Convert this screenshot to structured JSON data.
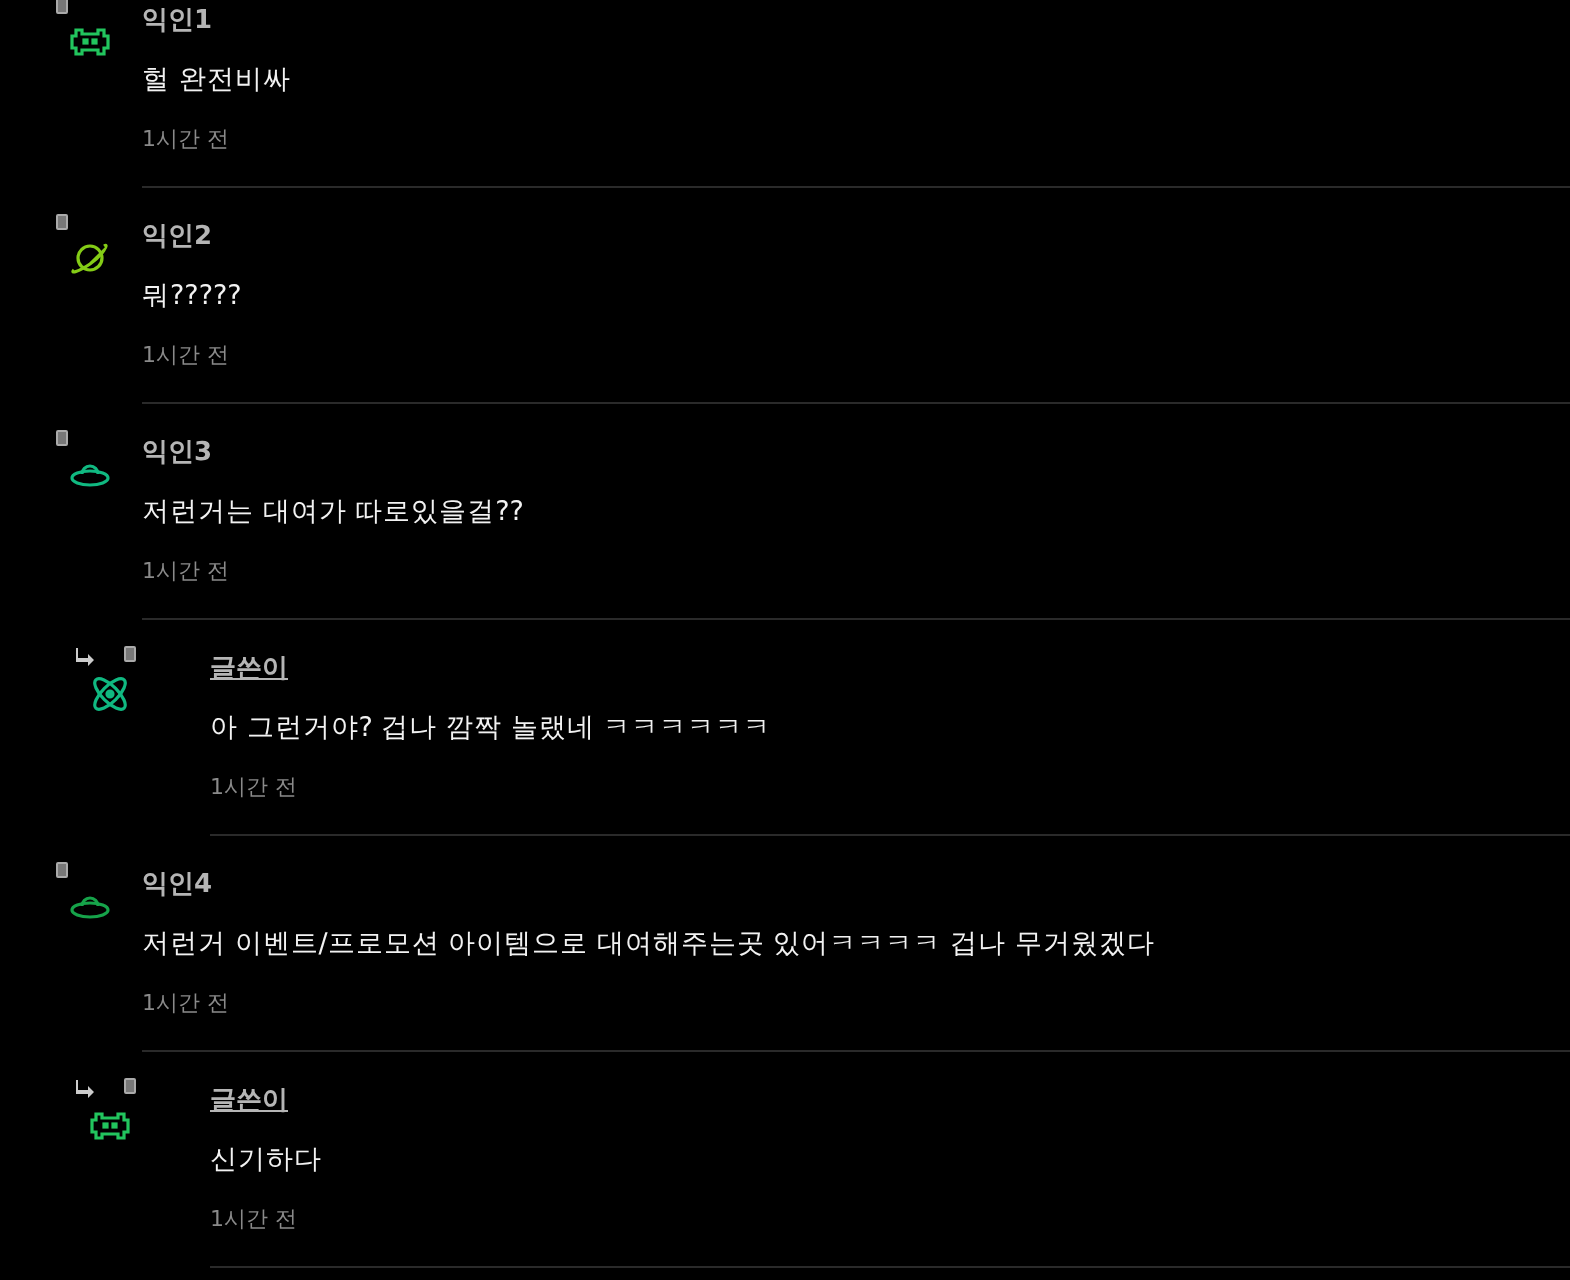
{
  "comments": [
    {
      "author": "익인1",
      "is_author": false,
      "kind": "alien",
      "color": "#22c55e",
      "text": "헐 완전비싸",
      "time": "1시간 전"
    },
    {
      "author": "익인2",
      "is_author": false,
      "kind": "planet",
      "color": "#84cc16",
      "text": "뭐?????",
      "time": "1시간 전"
    },
    {
      "author": "익인3",
      "is_author": false,
      "kind": "ufo",
      "color": "#10b981",
      "text": "저런거는 대여가 따로있을걸??",
      "time": "1시간 전",
      "children": [
        {
          "author": "글쓴이",
          "is_author": true,
          "kind": "atom",
          "color": "#10b981",
          "text": "아 그런거야? 겁나 깜짝 놀랬네 ㅋㅋㅋㅋㅋㅋ",
          "time": "1시간 전"
        }
      ]
    },
    {
      "author": "익인4",
      "is_author": false,
      "kind": "ufo",
      "color": "#16a34a",
      "text": "저런거 이벤트/프로모션 아이템으로 대여해주는곳 있어ㅋㅋㅋㅋ 겁나 무거웠겠다",
      "time": "1시간 전",
      "children": [
        {
          "author": "글쓴이",
          "is_author": true,
          "kind": "alien",
          "color": "#22c55e",
          "text": "신기하다",
          "time": "1시간 전"
        }
      ]
    }
  ]
}
